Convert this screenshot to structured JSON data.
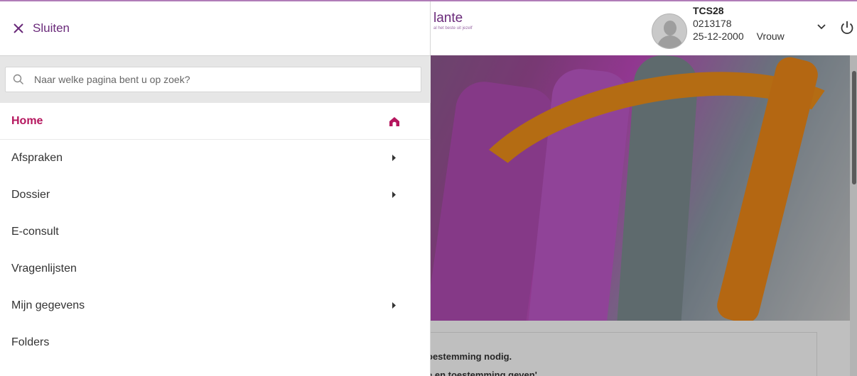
{
  "header": {
    "brand_name": "lante",
    "brand_tagline": "al het beste uit jezelf",
    "user": {
      "name": "TCS28",
      "number": "0213178",
      "dob": "25-12-2000",
      "sex": "Vrouw"
    },
    "icons": {
      "dropdown": "chevron-down-icon",
      "logout": "power-icon"
    }
  },
  "menu_panel": {
    "close_label": "Sluiten",
    "search": {
      "placeholder": "Naar welke pagina bent u op zoek?",
      "value": ""
    },
    "items": [
      {
        "label": "Home",
        "active": true,
        "icon": "home-icon"
      },
      {
        "label": "Afspraken",
        "has_submenu": true
      },
      {
        "label": "Dossier",
        "has_submenu": true
      },
      {
        "label": "E-consult"
      },
      {
        "label": "Vragenlijsten"
      },
      {
        "label": "Mijn gegevens",
        "has_submenu": true
      },
      {
        "label": "Folders"
      }
    ]
  },
  "background_content": {
    "consent_line_1": "oestemming nodig.",
    "consent_line_2": "e en toestemming geven'."
  },
  "colors": {
    "brand_purple": "#6a2a7a",
    "active_pink": "#b5165e",
    "search_bar_bg": "#e6e6e6"
  }
}
